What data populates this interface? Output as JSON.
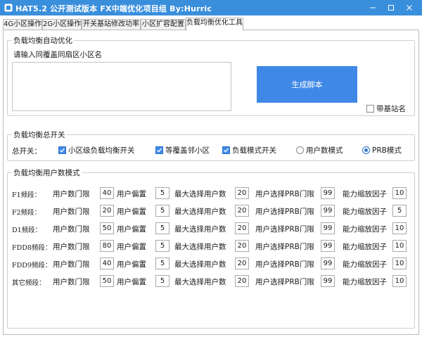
{
  "window": {
    "title": "HAT5.2 公开测试版本  FX中端优化项目组   By:Hurric",
    "controls": [
      "minimize-icon",
      "maximize-icon",
      "close-icon"
    ]
  },
  "tabs": [
    {
      "label": "4G小区操作",
      "active": false
    },
    {
      "label": "2G小区操作",
      "active": false
    },
    {
      "label": "开关基站修改功率",
      "active": false
    },
    {
      "label": "小区扩容配置",
      "active": false
    },
    {
      "label": "负载均衡优化工具",
      "active": true
    }
  ],
  "auto_opt": {
    "group_title": "负载均衡自动优化",
    "input_label": "请输入同覆盖同扇区小区名",
    "input_value": "",
    "generate_label": "生成脚本",
    "with_site_name": {
      "label": "带基站名",
      "checked": false
    }
  },
  "master": {
    "group_title": "负载均衡总开关",
    "main_label": "总开关：",
    "options": [
      {
        "label": "小区级负载均衡开关",
        "checked": true
      },
      {
        "label": "等覆盖邻小区",
        "checked": true
      },
      {
        "label": "负载模式开关",
        "checked": true
      }
    ],
    "mode": [
      {
        "label": "用户数模式",
        "selected": false
      },
      {
        "label": "PRB模式",
        "selected": true
      }
    ]
  },
  "user_mode": {
    "group_title": "负载均衡用户数模式",
    "columns": [
      "用户数门限",
      "用户偏置",
      "最大选择用户数",
      "用户选择PRB门限",
      "能力缩放因子"
    ],
    "rows": [
      {
        "band": "F1频段：",
        "values": [
          "40",
          "5",
          "20",
          "99",
          "10"
        ]
      },
      {
        "band": "F2频段：",
        "values": [
          "20",
          "5",
          "20",
          "99",
          "5"
        ]
      },
      {
        "band": "D1频段：",
        "values": [
          "50",
          "5",
          "20",
          "99",
          "10"
        ]
      },
      {
        "band": "FDD8频段：",
        "values": [
          "80",
          "5",
          "20",
          "99",
          "10"
        ]
      },
      {
        "band": "FDD9频段：",
        "values": [
          "40",
          "5",
          "20",
          "99",
          "10"
        ]
      },
      {
        "band": "其它频段：",
        "values": [
          "50",
          "5",
          "20",
          "99",
          "10"
        ]
      }
    ]
  },
  "colors": {
    "titlebar": "#3a8fdc",
    "accent": "#3f88e6"
  }
}
